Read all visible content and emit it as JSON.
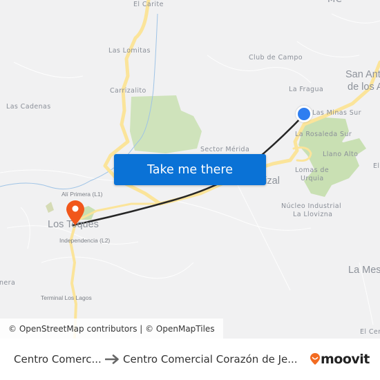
{
  "map": {
    "places": [
      {
        "id": "el-carite",
        "label": "El Carite"
      },
      {
        "id": "mc",
        "label": "MC"
      },
      {
        "id": "las-lomitas",
        "label": "Las Lomitas"
      },
      {
        "id": "club-de-campo",
        "label": "Club de Campo"
      },
      {
        "id": "san-antonio-line1",
        "label": "San Ant"
      },
      {
        "id": "san-antonio-line2",
        "label": "de los A"
      },
      {
        "id": "la-fragua",
        "label": "La Fragua"
      },
      {
        "id": "carrizalito",
        "label": "Carrizalito"
      },
      {
        "id": "las-cadenas",
        "label": "Las Cadenas"
      },
      {
        "id": "las-minas-sur",
        "label": "Las Minas Sur"
      },
      {
        "id": "la-rosaleda-sur",
        "label": "La Rosaleda Sur"
      },
      {
        "id": "sector-merida",
        "label": "Sector Mérida"
      },
      {
        "id": "llano-alto",
        "label": "Llano Alto"
      },
      {
        "id": "el-right",
        "label": "El"
      },
      {
        "id": "carrizal",
        "label": "Carrizal"
      },
      {
        "id": "lomas-de-urquia-1",
        "label": "Lomas de"
      },
      {
        "id": "lomas-de-urquia-2",
        "label": "Urquia"
      },
      {
        "id": "ali-primera",
        "label": "Alí Primera (L1)"
      },
      {
        "id": "los-teques",
        "label": "Los Teques"
      },
      {
        "id": "independencia",
        "label": "Independencia (L2)"
      },
      {
        "id": "nucleo-industrial-1",
        "label": "Núcleo Industrial"
      },
      {
        "id": "nucleo-industrial-2",
        "label": "La Llovizna"
      },
      {
        "id": "la-mesa",
        "label": "La Mes"
      },
      {
        "id": "nera",
        "label": "nera"
      },
      {
        "id": "terminal-los-lagos",
        "label": "Terminal Los Lagos"
      },
      {
        "id": "el-cerro",
        "label": "El Cer"
      }
    ],
    "take_me_there": "Take me there",
    "attribution": "© OpenStreetMap contributors | © OpenMapTiles",
    "colors": {
      "origin_marker": "#2f7ef0",
      "destination_marker": "#f1571b",
      "route_line": "#262626",
      "road": "#fbe49a",
      "park": "#c9e0b3",
      "background": "#f1f1f2",
      "button": "#0a72d6"
    }
  },
  "footer": {
    "from": "Centro Comerc...",
    "to": "Centro Comercial Corazón de Je...",
    "brand": "moovit",
    "brand_color": "#f26b21"
  }
}
